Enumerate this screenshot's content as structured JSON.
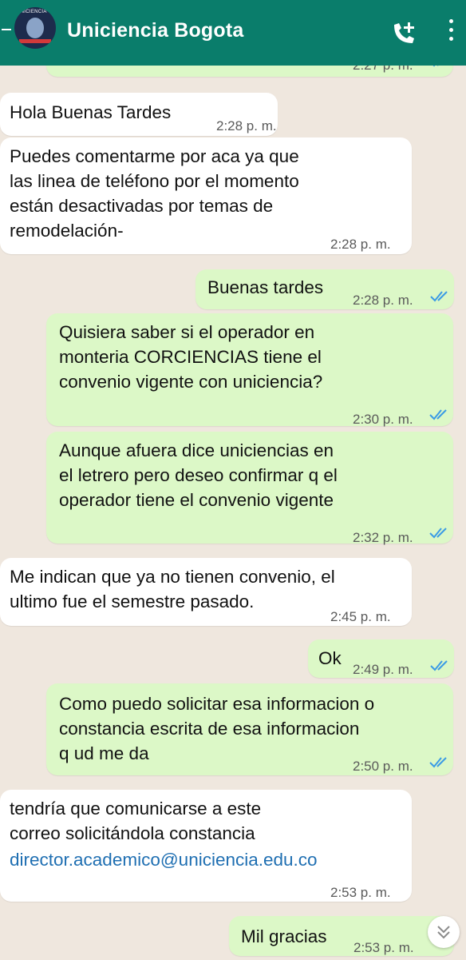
{
  "header": {
    "title": "Uniciencia Bogota",
    "avatar_label": "UNICIENCIA"
  },
  "messages": [
    {
      "dir": "out",
      "text": "",
      "time": "2:27 p. m.",
      "read": true
    },
    {
      "dir": "in",
      "text": "Hola Buenas Tardes",
      "time": "2:28 p. m."
    },
    {
      "dir": "in",
      "text": "Puedes comentarme por aca ya que\nlas linea de teléfono por el momento\nestán desactivadas por temas de\nremodelación-",
      "time": "2:28 p. m."
    },
    {
      "dir": "out",
      "text": "Buenas tardes",
      "time": "2:28 p. m.",
      "read": true
    },
    {
      "dir": "out",
      "text": "Quisiera saber si el operador en\nmonteria CORCIENCIAS tiene el\nconvenio vigente con uniciencia?",
      "time": "2:30 p. m.",
      "read": true
    },
    {
      "dir": "out",
      "text": "Aunque afuera dice uniciencias en\nel letrero pero deseo confirmar q el\noperador tiene el convenio vigente",
      "time": "2:32 p. m.",
      "read": true
    },
    {
      "dir": "in",
      "text": "Me indican que ya no tienen convenio, el\nultimo fue el semestre pasado.",
      "time": "2:45 p. m."
    },
    {
      "dir": "out",
      "text": "Ok",
      "time": "2:49 p. m.",
      "read": true
    },
    {
      "dir": "out",
      "text": "Como puedo solicitar esa informacion o\nconstancia escrita  de  esa informacion\nq ud me da",
      "time": "2:50 p. m.",
      "read": true
    },
    {
      "dir": "in",
      "text": "tendría que comunicarse a este\ncorreo solicitándola constancia",
      "link": "director.academico@uniciencia.edu.co",
      "time": "2:53 p. m."
    },
    {
      "dir": "out",
      "text": "Mil gracias",
      "time": "2:53 p. m.",
      "read": false
    }
  ],
  "colors": {
    "header": "#0a7d6b",
    "wallpaper": "#efe7de",
    "incoming": "#ffffff",
    "outgoing": "#dcf8c7",
    "tick_read": "#3b9be5",
    "link": "#1f6fb2"
  },
  "icons": [
    "back-arrow-icon",
    "add-call-icon",
    "more-options-icon",
    "double-check-icon",
    "scroll-down-icon"
  ]
}
